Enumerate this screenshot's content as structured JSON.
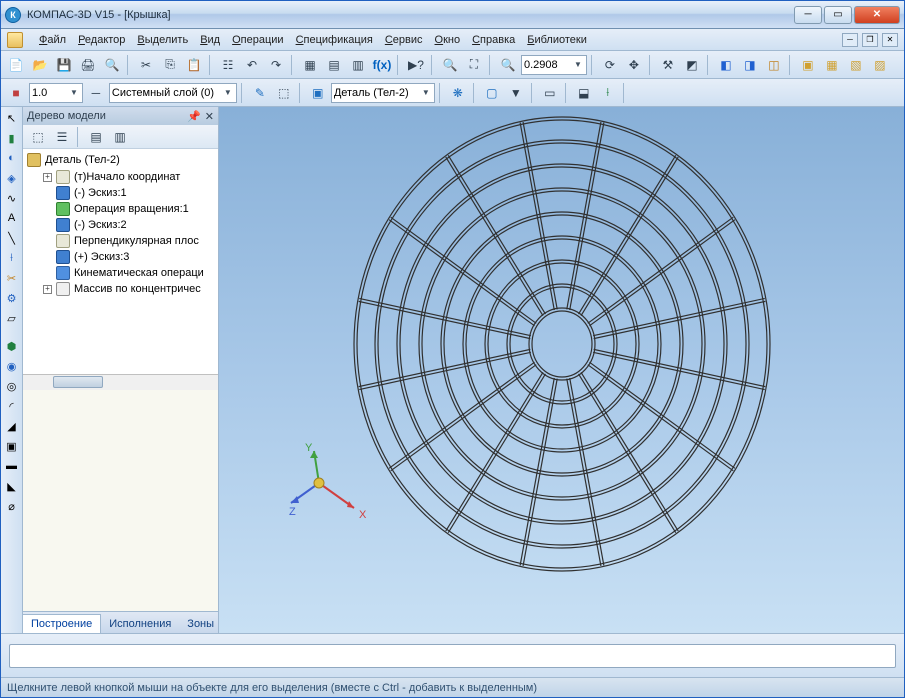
{
  "title": "КОМПАС-3D V15 - [Крышка]",
  "app_icon": "К",
  "menu": [
    "Файл",
    "Редактор",
    "Выделить",
    "Вид",
    "Операции",
    "Спецификация",
    "Сервис",
    "Окно",
    "Справка",
    "Библиотеки"
  ],
  "tb1": {
    "zoom_value": "0.2908",
    "fx": "f(x)"
  },
  "tb2": {
    "line_weight": "1.0",
    "layer": "Системный слой (0)",
    "body": "Деталь (Тел-2)"
  },
  "panel": {
    "title": "Дерево модели",
    "root": "Деталь (Тел-2)",
    "items": [
      {
        "exp": "+",
        "icon": "plane",
        "label": "(т)Начало координат"
      },
      {
        "exp": "",
        "icon": "sketch",
        "label": "(-) Эскиз:1"
      },
      {
        "exp": "",
        "icon": "op",
        "label": "Операция вращения:1"
      },
      {
        "exp": "",
        "icon": "sketch",
        "label": "(-) Эскиз:2"
      },
      {
        "exp": "",
        "icon": "plane",
        "label": "Перпендикулярная плос"
      },
      {
        "exp": "",
        "icon": "sketch",
        "label": "(+) Эскиз:3"
      },
      {
        "exp": "",
        "icon": "op2",
        "label": "Кинематическая операци"
      },
      {
        "exp": "+",
        "icon": "arr",
        "label": "Массив по концентричес"
      }
    ],
    "tabs": [
      "Построение",
      "Исполнения",
      "Зоны"
    ]
  },
  "axes": {
    "x": "X",
    "y": "Y",
    "z": "Z"
  },
  "status": "Щелкните левой кнопкой мыши на объекте для его выделения (вместе с Ctrl - добавить к выделенным)"
}
